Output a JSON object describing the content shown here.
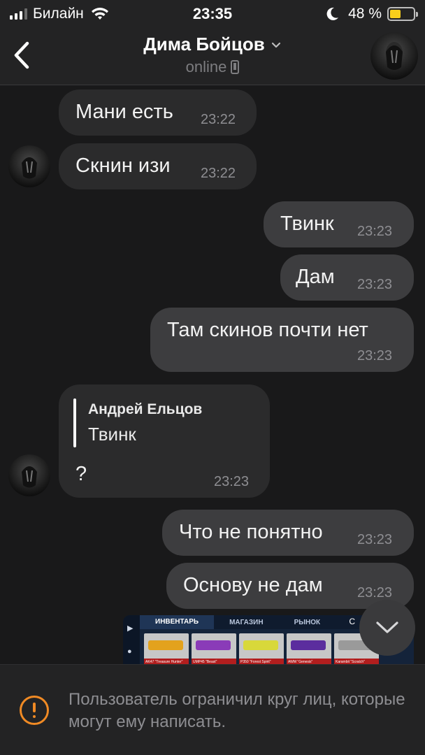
{
  "status_bar": {
    "carrier": "Билайн",
    "time": "23:35",
    "battery_text": "48 %",
    "battery_level": 0.48,
    "signal_bars": 3,
    "icons": [
      "signal-icon",
      "wifi-icon",
      "moon-icon",
      "battery-icon"
    ]
  },
  "header": {
    "contact_name": "Дима Бойцов",
    "status": "online",
    "icons": [
      "back-icon",
      "chevron-down-icon",
      "phone-icon",
      "avatar"
    ]
  },
  "messages": [
    {
      "direction": "incoming",
      "text": "Мани есть",
      "time": "23:22"
    },
    {
      "direction": "incoming",
      "text": "Скнин изи",
      "time": "23:22"
    },
    {
      "direction": "outgoing",
      "text": "Твинк",
      "time": "23:23"
    },
    {
      "direction": "outgoing",
      "text": "Дам",
      "time": "23:23"
    },
    {
      "direction": "outgoing",
      "text": "Там скинов почти нет",
      "time": "23:23"
    },
    {
      "direction": "incoming",
      "reply_author": "Андрей Ельцов",
      "reply_text": "Твинк",
      "text": "?",
      "time": "23:23"
    },
    {
      "direction": "outgoing",
      "text": "Что не понятно",
      "time": "23:23"
    },
    {
      "direction": "outgoing",
      "text": "Основу не дам",
      "time": "23:23"
    }
  ],
  "attachment": {
    "tabs": [
      "ИНВЕНТАРЬ",
      "МАГАЗИН",
      "РЫНОК"
    ],
    "items": [
      {
        "name": "AK47 \"Treasure Hunter\"",
        "color": "#e3a21d"
      },
      {
        "name": "UMP45 \"Beast\"",
        "color": "#8a3bb8"
      },
      {
        "name": "P350 \"Forest Spirit\"",
        "color": "#d8d83a"
      },
      {
        "name": "AWM \"Genesis\"",
        "color": "#5b2d9e"
      },
      {
        "name": "Karambit \"Scratch\"",
        "color": "#9a9a9a"
      }
    ]
  },
  "restriction": {
    "text": "Пользователь ограничил круг лиц, которые могут ему написать."
  },
  "colors": {
    "background": "#19191a",
    "incoming_bubble": "#2b2b2c",
    "outgoing_bubble": "#3d3d3f",
    "warning": "#f08a24",
    "battery": "#f7ce1b"
  }
}
